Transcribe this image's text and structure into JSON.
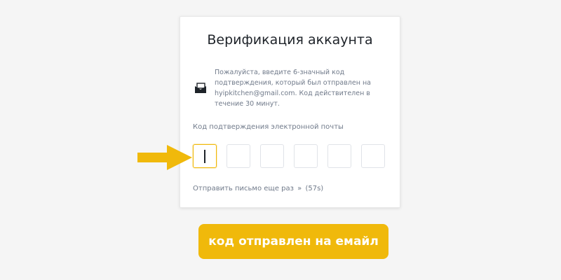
{
  "card": {
    "title": "Верификация аккаунта",
    "info_text": "Пожалуйста, введите 6-значный код подтверждения, который был отправлен на hyipkitchen@gmail.com. Код действителен в течение 30 минут.",
    "field_label": "Код подтверждения электронной почты",
    "code_boxes": [
      "",
      "",
      "",
      "",
      "",
      ""
    ],
    "resend": {
      "label": "Отправить письмо еще раз",
      "chevron": "»",
      "timer": "(57s)"
    },
    "icon": "envelope-icon"
  },
  "annotation": {
    "arrow_icon": "arrow-right-icon",
    "arrow_color": "#f0b90b"
  },
  "cta": {
    "label": "код отправлен на емайл",
    "color": "#f0b90b"
  }
}
